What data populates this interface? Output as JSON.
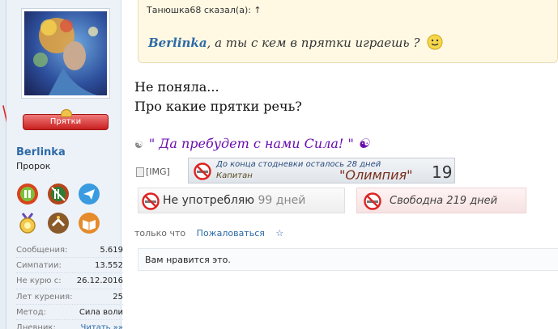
{
  "user": {
    "name": "Berlinka",
    "title": "Пророк",
    "banner_label": "Прятки",
    "stats": [
      {
        "label": "Сообщения:",
        "value": "5.619"
      },
      {
        "label": "Симпатии:",
        "value": "13.552"
      },
      {
        "label": "Не курю с:",
        "value": "26.12.2016"
      },
      {
        "label": "Лет курения:",
        "value": "25"
      },
      {
        "label": "Метод:",
        "value": "Сила воли"
      },
      {
        "label": "Дневник:",
        "value": "Читать »»"
      }
    ]
  },
  "quote": {
    "header": "Танюшка68 сказал(а): ↑",
    "name": "Berlinka",
    "text": ", а ты с кем в прятки играешь ?"
  },
  "message": {
    "line1": "Не поняла...",
    "line2": "Про какие прятки речь?"
  },
  "signature": {
    "mark": "☯",
    "text": "\" Да пребудет с нами Сила! \" ☯",
    "img_alt": "[IMG]"
  },
  "counters": {
    "c1_line1": "До конца стодневки осталось 28 дней",
    "c1_line2": "Капитан",
    "c1_team": "\"Олимпия\"",
    "c1_num": "19",
    "c2_text": "Не употребляю",
    "c2_num": "99 дней",
    "c3_text": "Свободна 219 дней"
  },
  "meta": {
    "time": "только что",
    "report": "Пожаловаться",
    "star": "☆"
  },
  "likes": {
    "text": "Вам нравится это."
  },
  "colors": {
    "link": "#2e6aa6",
    "signature": "#6a0dad",
    "banner": "#c91f1f"
  }
}
